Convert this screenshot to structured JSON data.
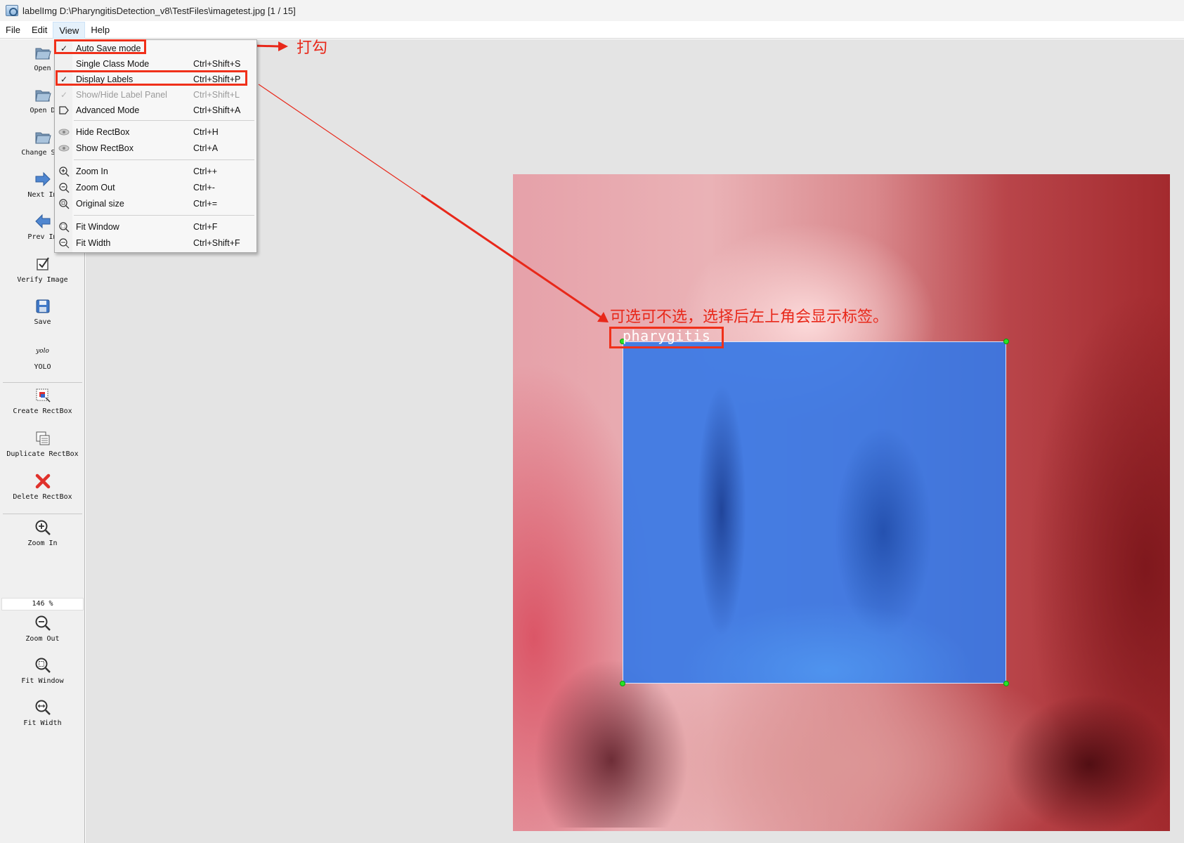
{
  "window": {
    "title": "labelImg D:\\PharyngitisDetection_v8\\TestFiles\\imagetest.jpg [1 / 15]"
  },
  "menubar": {
    "items": [
      "File",
      "Edit",
      "View",
      "Help"
    ]
  },
  "toolbar": {
    "items": [
      {
        "label": "Open",
        "icon": "open-folder-icon"
      },
      {
        "label": "Open D",
        "icon": "open-dir-icon"
      },
      {
        "label": "Change Sav",
        "icon": "change-save-dir-icon"
      },
      {
        "label": "Next Im",
        "icon": "next-image-icon"
      },
      {
        "label": "Prev Im",
        "icon": "prev-image-icon"
      },
      {
        "label": "Verify Image",
        "icon": "verify-icon"
      },
      {
        "label": "Save",
        "icon": "save-icon"
      },
      {
        "label": "YOLO",
        "icon": "yolo-icon",
        "icon_text": "yolo"
      },
      {
        "label": "Create RectBox",
        "icon": "create-rectbox-icon"
      },
      {
        "label": "Duplicate RectBox",
        "icon": "duplicate-rectbox-icon"
      },
      {
        "label": "Delete RectBox",
        "icon": "delete-icon"
      },
      {
        "label": "Zoom In",
        "icon": "zoom-in-icon"
      },
      {
        "label": "Zoom Out",
        "icon": "zoom-out-icon"
      },
      {
        "label": "Fit Window",
        "icon": "fit-window-icon"
      },
      {
        "label": "Fit Width",
        "icon": "fit-width-icon"
      }
    ],
    "zoom_value": "146 %"
  },
  "view_menu": {
    "items": [
      {
        "label": "Auto Save mode",
        "shortcut": "",
        "checked": true
      },
      {
        "label": "Single Class Mode",
        "shortcut": "Ctrl+Shift+S",
        "checked": false
      },
      {
        "label": "Display Labels",
        "shortcut": "Ctrl+Shift+P",
        "checked": true
      },
      {
        "label": "Show/Hide Label Panel",
        "shortcut": "Ctrl+Shift+L",
        "checked": true,
        "disabled": true
      },
      {
        "label": "Advanced Mode",
        "shortcut": "Ctrl+Shift+A",
        "checked": false
      },
      {
        "label": "Hide RectBox",
        "shortcut": "Ctrl+H"
      },
      {
        "label": "Show RectBox",
        "shortcut": "Ctrl+A"
      },
      {
        "label": "Zoom In",
        "shortcut": "Ctrl++"
      },
      {
        "label": "Zoom Out",
        "shortcut": "Ctrl+-"
      },
      {
        "label": "Original size",
        "shortcut": "Ctrl+="
      },
      {
        "label": "Fit Window",
        "shortcut": "Ctrl+F"
      },
      {
        "label": "Fit Width",
        "shortcut": "Ctrl+Shift+F"
      }
    ]
  },
  "canvas": {
    "box_label": "pharygitis"
  },
  "annotations": {
    "tick_note": "打勾",
    "labels_note": "可选可不选，选择后左上角会显示标签。",
    "color": "#e8281a"
  }
}
